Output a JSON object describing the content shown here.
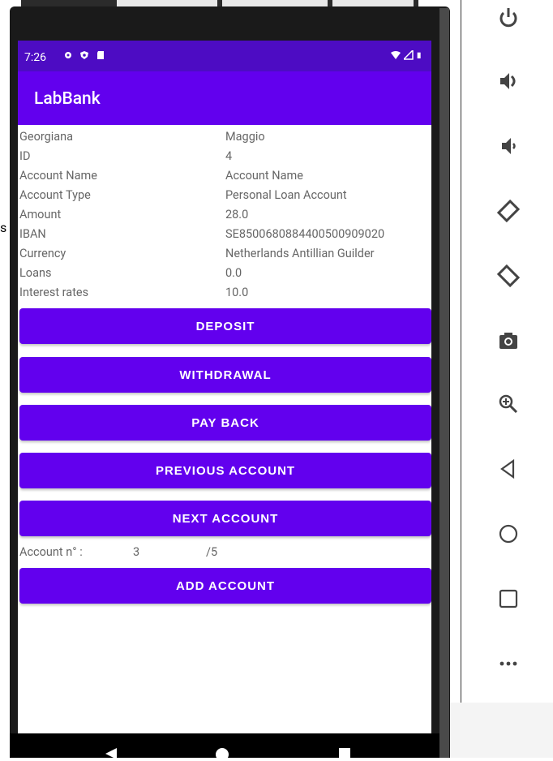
{
  "stray_text": "s",
  "status_bar": {
    "time": "7:26"
  },
  "app": {
    "title": "LabBank"
  },
  "account_info": [
    {
      "label": "Georgiana",
      "value": "Maggio"
    },
    {
      "label": "ID",
      "value": "4"
    },
    {
      "label": "Account Name",
      "value": "Account Name"
    },
    {
      "label": "Account Type",
      "value": "Personal Loan Account"
    },
    {
      "label": "Amount",
      "value": "28.0"
    },
    {
      "label": "IBAN",
      "value": "SE8500680884400500909020"
    },
    {
      "label": "Currency",
      "value": "Netherlands Antillian Guilder"
    },
    {
      "label": "Loans",
      "value": "0.0"
    },
    {
      "label": "Interest rates",
      "value": "10.0"
    }
  ],
  "buttons": {
    "deposit": "DEPOSIT",
    "withdrawal": "WITHDRAWAL",
    "pay_back": "PAY BACK",
    "previous_account": "PREVIOUS ACCOUNT",
    "next_account": "NEXT ACCOUNT",
    "add_account": "ADD ACCOUNT"
  },
  "account_counter": {
    "label": "Account n° :",
    "current": "3",
    "total": "/5"
  },
  "emulator_controls": [
    "power-icon",
    "volume-up-icon",
    "volume-down-icon",
    "rotate-left-icon",
    "rotate-right-icon",
    "camera-icon",
    "zoom-icon",
    "back-icon",
    "home-icon",
    "overview-icon",
    "more-icon"
  ],
  "colors": {
    "primary": "#6200ee",
    "primary_dark": "#4d0cc3",
    "side_icon": "#444444"
  }
}
